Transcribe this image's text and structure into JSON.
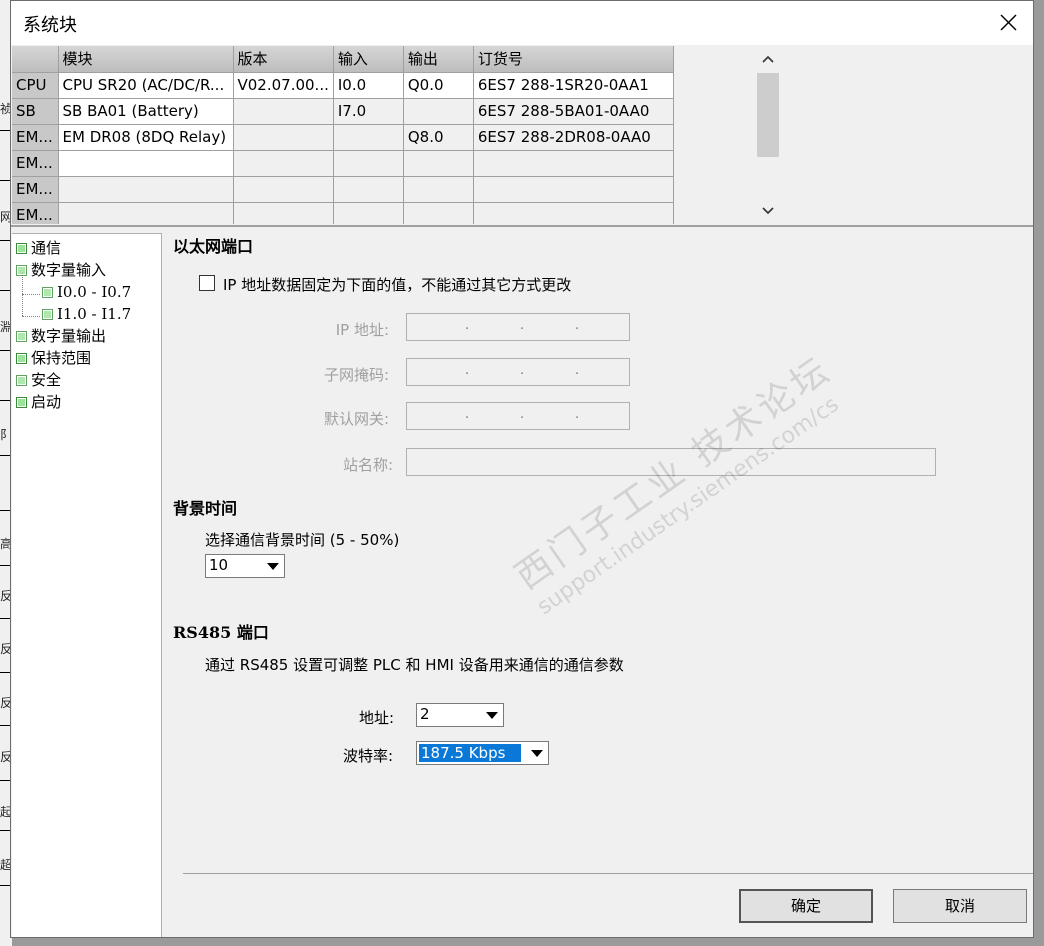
{
  "window": {
    "title": "系统块"
  },
  "table": {
    "headers": [
      "",
      "模块",
      "版本",
      "输入",
      "输出",
      "订货号"
    ],
    "rows": [
      [
        "CPU",
        "CPU SR20 (AC/DC/R...",
        "V02.07.00...",
        "I0.0",
        "Q0.0",
        "6ES7 288-1SR20-0AA1"
      ],
      [
        "SB",
        "SB BA01 (Battery)",
        "",
        "I7.0",
        "",
        "6ES7 288-5BA01-0AA0"
      ],
      [
        "EM...",
        "EM DR08 (8DQ Relay)",
        "",
        "",
        "Q8.0",
        "6ES7 288-2DR08-0AA0"
      ],
      [
        "EM...",
        "",
        "",
        "",
        "",
        ""
      ],
      [
        "EM...",
        "",
        "",
        "",
        "",
        ""
      ],
      [
        "EM...",
        "",
        "",
        "",
        "",
        ""
      ]
    ]
  },
  "tree": {
    "communication": "通信",
    "digital_input": "数字量输入",
    "di_range1": "I0.0 - I0.7",
    "di_range2": "I1.0 - I1.7",
    "digital_output": "数字量输出",
    "retentive": "保持范围",
    "security": "安全",
    "startup": "启动"
  },
  "ethernet": {
    "title": "以太网端口",
    "fix_ip_label": "IP 地址数据固定为下面的值，不能通过其它方式更改",
    "ip_label": "IP 地址:",
    "subnet_label": "子网掩码:",
    "gateway_label": "默认网关:",
    "station_label": "站名称:",
    "dot": "."
  },
  "background": {
    "title": "背景时间",
    "select_label": "选择通信背景时间 (5 - 50%)",
    "value": "10"
  },
  "rs485": {
    "title": "RS485  端口",
    "description": "通过 RS485 设置可调整 PLC 和 HMI 设备用来通信的通信参数",
    "address_label": "地址:",
    "address_value": "2",
    "baud_label": "波特率:",
    "baud_value": "187.5 Kbps"
  },
  "buttons": {
    "ok": "确定",
    "cancel": "取消"
  },
  "watermark": {
    "line1": "西门子工业 技术论坛",
    "line2": "support.industry.siemens.com/cs"
  },
  "bg_fragments": [
    "祯",
    "网",
    "淵",
    "阝",
    "高",
    "反",
    "反",
    "反",
    "反",
    "起",
    "超"
  ]
}
